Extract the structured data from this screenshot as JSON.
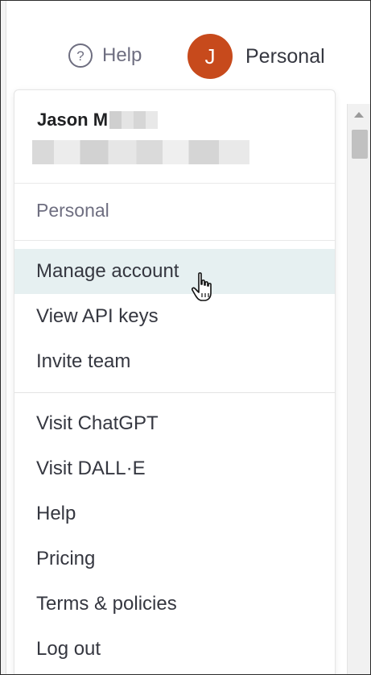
{
  "header": {
    "help_label": "Help",
    "help_icon": "help-circle-icon",
    "account_label": "Personal",
    "avatar_letter": "J",
    "avatar_color": "#c74a1c"
  },
  "menu": {
    "user_name": "Jason M",
    "org_label": "Personal",
    "account_items": [
      {
        "label": "Manage account",
        "active": true
      },
      {
        "label": "View API keys"
      },
      {
        "label": "Invite team"
      }
    ],
    "link_items": [
      {
        "label": "Visit ChatGPT"
      },
      {
        "label": "Visit DALL·E"
      },
      {
        "label": "Help"
      },
      {
        "label": "Pricing"
      },
      {
        "label": "Terms & policies"
      },
      {
        "label": "Log out"
      }
    ],
    "hover_color": "#e6f0f1"
  }
}
